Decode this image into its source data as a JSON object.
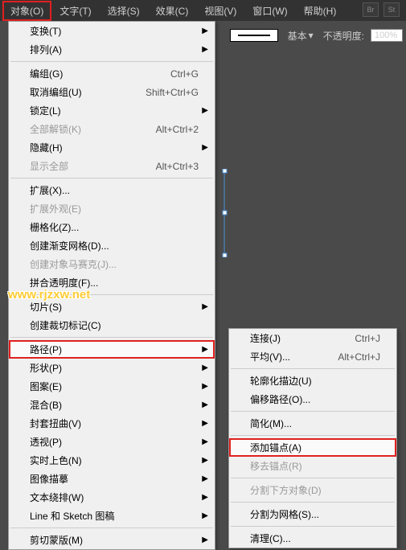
{
  "menubar": {
    "items": [
      {
        "label": "对象(O)",
        "highlighted": true
      },
      {
        "label": "文字(T)"
      },
      {
        "label": "选择(S)"
      },
      {
        "label": "效果(C)"
      },
      {
        "label": "视图(V)"
      },
      {
        "label": "窗口(W)"
      },
      {
        "label": "帮助(H)"
      }
    ],
    "right_icons": [
      "Br",
      "St"
    ]
  },
  "options_bar": {
    "style_label": "基本",
    "opacity_label": "不透明度:",
    "opacity_value": "100%"
  },
  "main_menu": [
    {
      "label": "变换(T)",
      "submenu": true
    },
    {
      "label": "排列(A)",
      "submenu": true
    },
    {
      "sep": true
    },
    {
      "label": "编组(G)",
      "shortcut": "Ctrl+G"
    },
    {
      "label": "取消编组(U)",
      "shortcut": "Shift+Ctrl+G"
    },
    {
      "label": "锁定(L)",
      "submenu": true
    },
    {
      "label": "全部解锁(K)",
      "shortcut": "Alt+Ctrl+2",
      "disabled": true
    },
    {
      "label": "隐藏(H)",
      "submenu": true
    },
    {
      "label": "显示全部",
      "shortcut": "Alt+Ctrl+3",
      "disabled": true
    },
    {
      "sep": true
    },
    {
      "label": "扩展(X)..."
    },
    {
      "label": "扩展外观(E)",
      "disabled": true
    },
    {
      "label": "栅格化(Z)..."
    },
    {
      "label": "创建渐变网格(D)..."
    },
    {
      "label": "创建对象马赛克(J)...",
      "disabled": true
    },
    {
      "label": "拼合透明度(F)..."
    },
    {
      "sep": true
    },
    {
      "label": "切片(S)",
      "submenu": true
    },
    {
      "label": "创建裁切标记(C)"
    },
    {
      "sep": true
    },
    {
      "label": "路径(P)",
      "submenu": true,
      "highlighted": true
    },
    {
      "label": "形状(P)",
      "submenu": true
    },
    {
      "label": "图案(E)",
      "submenu": true
    },
    {
      "label": "混合(B)",
      "submenu": true
    },
    {
      "label": "封套扭曲(V)",
      "submenu": true
    },
    {
      "label": "透视(P)",
      "submenu": true
    },
    {
      "label": "实时上色(N)",
      "submenu": true
    },
    {
      "label": "图像描摹",
      "submenu": true
    },
    {
      "label": "文本绕排(W)",
      "submenu": true
    },
    {
      "label": "Line 和 Sketch 图稿",
      "submenu": true
    },
    {
      "sep": true
    },
    {
      "label": "剪切蒙版(M)",
      "submenu": true
    }
  ],
  "sub_menu": [
    {
      "label": "连接(J)",
      "shortcut": "Ctrl+J"
    },
    {
      "label": "平均(V)...",
      "shortcut": "Alt+Ctrl+J"
    },
    {
      "sep": true
    },
    {
      "label": "轮廓化描边(U)"
    },
    {
      "label": "偏移路径(O)..."
    },
    {
      "sep": true
    },
    {
      "label": "简化(M)..."
    },
    {
      "sep": true
    },
    {
      "label": "添加锚点(A)",
      "highlighted": true
    },
    {
      "label": "移去锚点(R)",
      "disabled": true
    },
    {
      "sep": true
    },
    {
      "label": "分割下方对象(D)",
      "disabled": true
    },
    {
      "sep": true
    },
    {
      "label": "分割为网格(S)..."
    },
    {
      "sep": true
    },
    {
      "label": "清理(C)..."
    }
  ],
  "watermark": "www.rjzxw.net"
}
